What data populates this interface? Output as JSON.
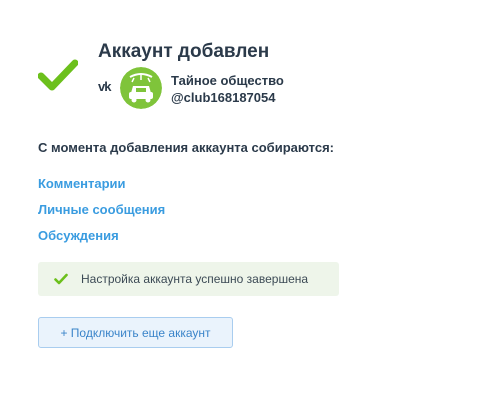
{
  "header": {
    "title": "Аккаунт добавлен",
    "network_icon": "vk-icon",
    "network_label": "vk"
  },
  "account": {
    "name": "Тайное общество",
    "handle": "@club168187054",
    "avatar_icon": "car-wash-avatar-icon"
  },
  "collecting": {
    "title": "С момента добавления аккаунта собираются:",
    "items": [
      {
        "label": "Комментарии"
      },
      {
        "label": "Личные сообщения"
      },
      {
        "label": "Обсуждения"
      }
    ]
  },
  "status": {
    "message": "Настройка аккаунта успешно завершена",
    "color": "#6cc01c"
  },
  "actions": {
    "add_account_label": "+ Подключить еще аккаунт"
  },
  "colors": {
    "accent": "#3a9ce0",
    "success": "#6cc01c",
    "avatar_bg": "#7fc43a"
  }
}
